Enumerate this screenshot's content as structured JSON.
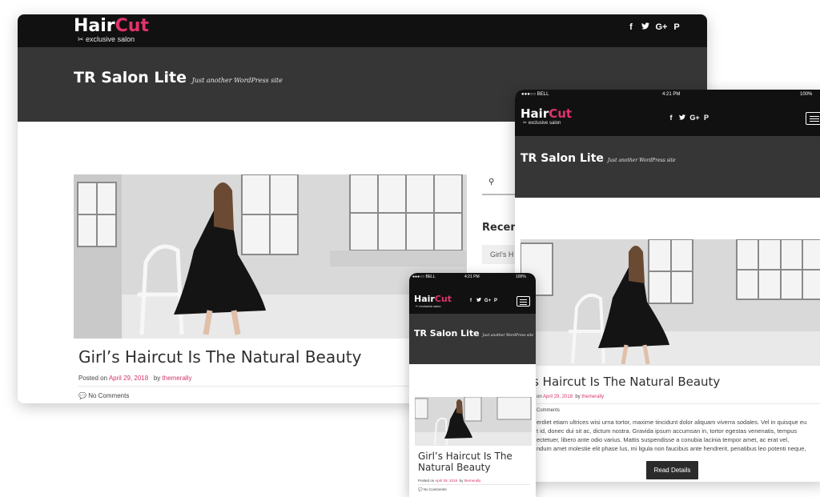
{
  "brand": {
    "logo_word1": "Hair",
    "logo_word2": "Cut",
    "logo_tagline": "exclusive salon",
    "accent_color": "#e2336b",
    "header_color": "#111111",
    "hero_color": "#363636"
  },
  "social_icons": [
    {
      "icon": "facebook-icon",
      "glyph": "f"
    },
    {
      "icon": "twitter-icon",
      "glyph": "🐦"
    },
    {
      "icon": "google-plus-icon",
      "glyph": "G+"
    },
    {
      "icon": "pinterest-icon",
      "glyph": "P"
    }
  ],
  "site": {
    "title": "TR Salon Lite",
    "tagline": "Just another WordPress site"
  },
  "desktop": {
    "post_title": "Girl’s Haircut Is The Natural Beauty",
    "posted_on_label": "Posted on",
    "date": "April 29, 2018",
    "by_label": "by",
    "author": "themerally",
    "comments": "No Comments",
    "sidebar_recent_heading": "Recen",
    "sidebar_recent_item": "Girl’s H"
  },
  "tablet": {
    "status_carrier": "●●●○○ BELL",
    "status_time": "4:21 PM",
    "status_battery": "100%",
    "post_title": "rl’s Haircut Is The Natural Beauty",
    "posted_on_label": "on",
    "date": "April 29, 2018",
    "by_label": "by",
    "author": "themerally",
    "comments": "Comments",
    "excerpt_lines": [
      "erdiet etiam ultrices wisi urna tortor, maxime tincidunt dolor aliquam viverra sodales. Vel in quisque eu",
      "t id, donec dui sit ac, dictum nostra. Gravida ipsum accumsan in, tortor egestas venenatis, tempus",
      "ectetuer, libero ante odio varius. Mattis suspendisse a conubia lacinia tempor amet, ac erat vel,",
      "ndum amet molestie elit phase lus, mi ligula non faucibus ante hendrerit, penatibus leo potenti neque,"
    ],
    "read_details": "Read Details"
  },
  "phone": {
    "status_carrier": "●●●○○ BELL",
    "status_time": "4:21 PM",
    "status_battery": "100%",
    "post_title_line1": "Girl’s Haircut Is The",
    "post_title_line2": "Natural Beauty",
    "posted_on_label": "Posted on",
    "date": "April 29, 2018",
    "by_label": "by",
    "author": "themerally",
    "comments": "No Comments"
  }
}
